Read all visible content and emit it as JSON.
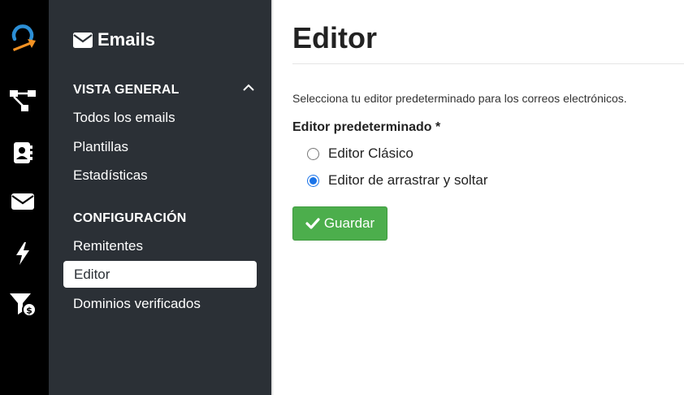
{
  "colors": {
    "rail_bg": "#000000",
    "sidebar_bg": "#2b3036",
    "accent_blue": "#2c8fd6",
    "accent_orange": "#f39223",
    "save_green": "#4cae4c"
  },
  "rail": {
    "icons": [
      "brand-logo-icon",
      "workflow-icon",
      "contacts-icon",
      "envelope-icon",
      "lightning-icon",
      "funnel-dollar-icon"
    ]
  },
  "sidebar": {
    "title": "Emails",
    "title_icon": "envelope-icon",
    "sections": [
      {
        "label": "VISTA GENERAL",
        "items": [
          "Todos los emails",
          "Plantillas",
          "Estadísticas"
        ]
      },
      {
        "label": "CONFIGURACIÓN",
        "items": [
          "Remitentes",
          "Editor",
          "Dominios verificados"
        ]
      }
    ],
    "active_item": "Editor"
  },
  "main": {
    "title": "Editor",
    "description": "Selecciona tu editor predeterminado para los correos electrónicos.",
    "field_label": "Editor predeterminado *",
    "options": [
      {
        "label": "Editor Clásico",
        "selected": false
      },
      {
        "label": "Editor de arrastrar y soltar",
        "selected": true
      }
    ],
    "save_label": "Guardar"
  }
}
